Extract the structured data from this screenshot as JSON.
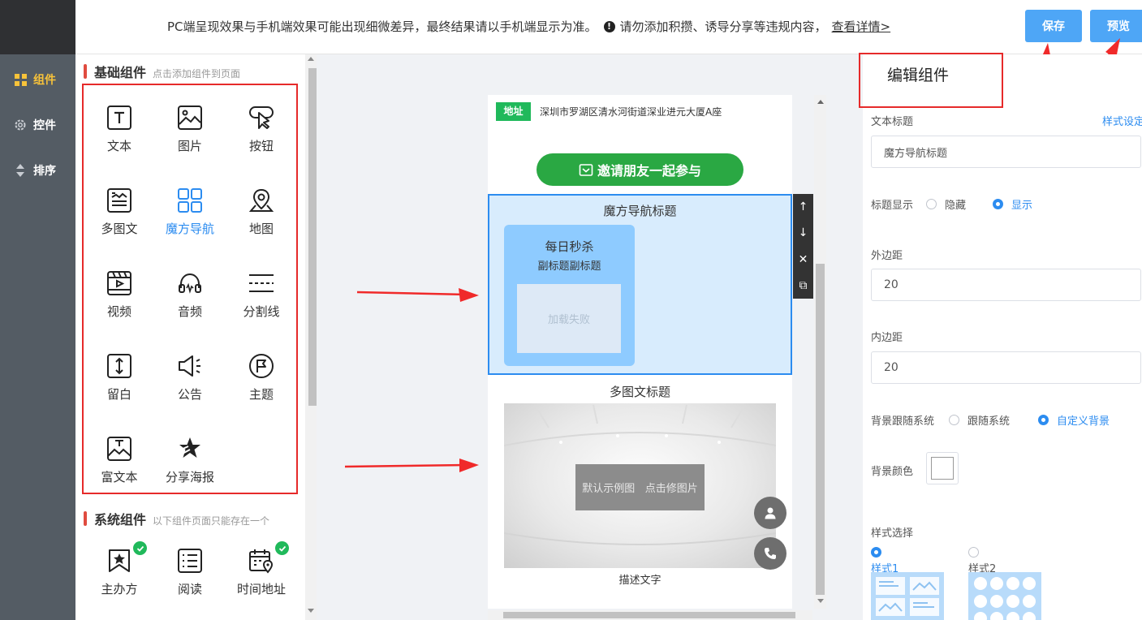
{
  "sidebar": {
    "items": [
      {
        "label": "组件",
        "icon": "grid-icon"
      },
      {
        "label": "控件",
        "icon": "gear-icon"
      },
      {
        "label": "排序",
        "icon": "sort-icon"
      }
    ],
    "active_color": "#f8c33a"
  },
  "topbar": {
    "notice": "PC端呈现效果与手机端效果可能出现细微差异，最终结果请以手机端显示为准。",
    "warning": "请勿添加积攒、诱导分享等违规内容，",
    "details_link": "查看详情>",
    "save_label": "保存",
    "preview_label": "预览"
  },
  "library": {
    "basic": {
      "title": "基础组件",
      "hint": "点击添加组件到页面",
      "items": [
        {
          "label": "文本",
          "icon": "text-icon"
        },
        {
          "label": "图片",
          "icon": "image-icon"
        },
        {
          "label": "按钮",
          "icon": "button-icon"
        },
        {
          "label": "多图文",
          "icon": "multi-image-text-icon"
        },
        {
          "label": "魔方导航",
          "icon": "cube-nav-icon",
          "selected": true
        },
        {
          "label": "地图",
          "icon": "map-icon"
        },
        {
          "label": "视频",
          "icon": "video-icon"
        },
        {
          "label": "音频",
          "icon": "audio-icon"
        },
        {
          "label": "分割线",
          "icon": "divider-icon"
        },
        {
          "label": "留白",
          "icon": "spacer-icon"
        },
        {
          "label": "公告",
          "icon": "announcement-icon"
        },
        {
          "label": "主题",
          "icon": "theme-icon"
        },
        {
          "label": "富文本",
          "icon": "rich-text-icon"
        },
        {
          "label": "分享海报",
          "icon": "share-poster-icon"
        }
      ]
    },
    "system": {
      "title": "系统组件",
      "hint": "以下组件页面只能存在一个",
      "items": [
        {
          "label": "主办方",
          "icon": "organizer-icon",
          "added": true
        },
        {
          "label": "阅读",
          "icon": "reading-icon",
          "added": false
        },
        {
          "label": "时间地址",
          "icon": "time-address-icon",
          "added": true
        }
      ]
    }
  },
  "phone": {
    "address_tag": "地址",
    "address": "深圳市罗湖区清水河街道深业进元大厦A座",
    "invite_button": "邀请朋友一起参与",
    "cube_nav": {
      "title": "魔方导航标题",
      "card_title": "每日秒杀",
      "card_subtitle": "副标题副标题",
      "image_error": "加载失败"
    },
    "multi_image": {
      "title": "多图文标题",
      "overlay_text": "默认示例图   点击修图片",
      "description": "描述文字"
    },
    "tools": [
      "↑",
      "↓",
      "✕",
      "⧉"
    ],
    "accent_green": "#20b95b"
  },
  "editor": {
    "title": "编辑组件",
    "text_title_label": "文本标题",
    "style_setting": "样式设定",
    "text_title_value": "魔方导航标题",
    "title_display_label": "标题显示",
    "title_display_options": [
      "隐藏",
      "显示"
    ],
    "title_display_selected": "显示",
    "margin_label": "外边距",
    "margin_value": "20",
    "padding_label": "内边距",
    "padding_value": "20",
    "bg_follow_label": "背景跟随系统",
    "bg_follow_options": [
      "跟随系统",
      "自定义背景"
    ],
    "bg_follow_selected": "自定义背景",
    "bg_color_label": "背景颜色",
    "style_select_label": "样式选择",
    "styles": [
      "样式1",
      "样式2"
    ],
    "style_selected": "样式1",
    "accent_blue": "#2c8cf0"
  }
}
